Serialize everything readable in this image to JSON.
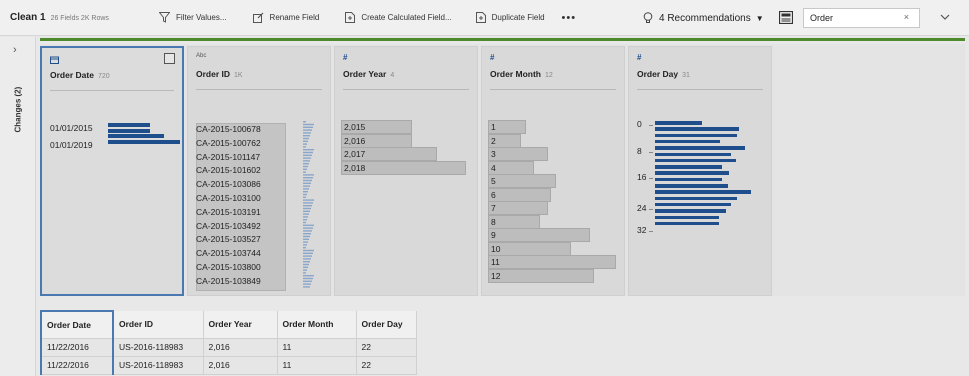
{
  "toolbar": {
    "step_name": "Clean 1",
    "step_meta": "26 Fields  2K Rows",
    "filter_label": "Filter Values...",
    "rename_label": "Rename Field",
    "calc_label": "Create Calculated Field...",
    "duplicate_label": "Duplicate Field",
    "more_label": "•••",
    "recommendations_label": "4 Recommendations",
    "search_value": "Order",
    "clear_icon": "×"
  },
  "rail": {
    "expand_icon": "›",
    "changes_label": "Changes (2)"
  },
  "cards": [
    {
      "name": "Order Date",
      "count": "720",
      "type_icon": "calendar-icon",
      "axis_labels": [
        "01/01/2015",
        "01/01/2019"
      ],
      "bar_fractions": [
        0.58,
        0.58,
        0.78,
        1.0
      ]
    },
    {
      "name": "Order ID",
      "count": "1K",
      "type_label": "Abc",
      "values": [
        "CA-2015-100678",
        "CA-2015-100762",
        "CA-2015-101147",
        "CA-2015-101602",
        "CA-2015-103086",
        "CA-2015-103100",
        "CA-2015-103191",
        "CA-2015-103492",
        "CA-2015-103527",
        "CA-2015-103744",
        "CA-2015-103800",
        "CA-2015-103849"
      ]
    },
    {
      "name": "Order Year",
      "count": "4",
      "type_label": "#",
      "values": [
        "2,015",
        "2,016",
        "2,017",
        "2,018"
      ],
      "bar_fractions": [
        0.57,
        0.57,
        0.77,
        1.0
      ]
    },
    {
      "name": "Order Month",
      "count": "12",
      "type_label": "#",
      "values": [
        "1",
        "2",
        "3",
        "4",
        "5",
        "6",
        "7",
        "8",
        "9",
        "10",
        "11",
        "12"
      ],
      "bar_fractions": [
        0.3,
        0.26,
        0.47,
        0.36,
        0.53,
        0.49,
        0.47,
        0.41,
        0.8,
        0.65,
        1.0,
        0.83
      ]
    },
    {
      "name": "Order Day",
      "count": "31",
      "type_label": "#",
      "axis_labels": [
        "0",
        "8",
        "16",
        "24",
        "32"
      ],
      "bar_fractions": [
        0.42,
        0.75,
        0.73,
        0.58,
        0.8,
        0.68,
        0.72,
        0.6,
        0.66,
        0.6,
        0.65,
        0.86,
        0.73,
        0.68,
        0.63,
        0.57,
        0.57
      ]
    }
  ],
  "grid": {
    "columns": [
      "Order Date",
      "Order ID",
      "Order Year",
      "Order Month",
      "Order Day"
    ],
    "rows": [
      [
        "11/22/2016",
        "US-2016-118983",
        "2,016",
        "11",
        "22"
      ],
      [
        "11/22/2016",
        "US-2016-118983",
        "2,016",
        "11",
        "22"
      ]
    ]
  },
  "colors": {
    "accent": "#4a78b0",
    "bar_dark": "#1f4e8c",
    "progress_green": "#4d8a2c"
  }
}
